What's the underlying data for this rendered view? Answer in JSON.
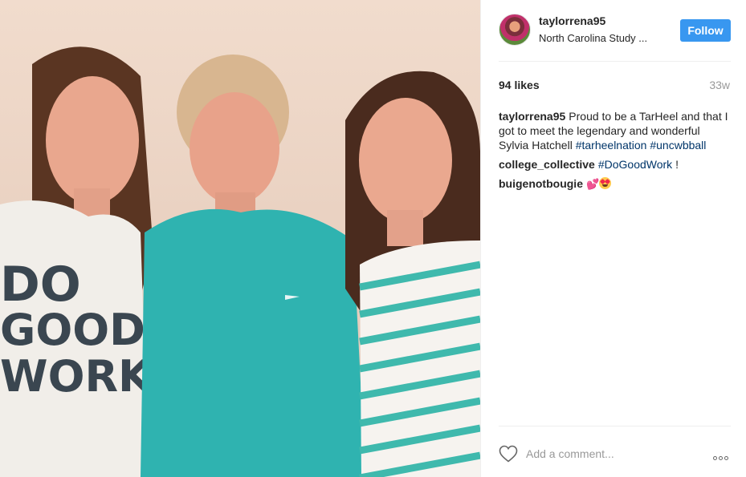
{
  "post": {
    "username": "taylorrena95",
    "location": "North Carolina Study ...",
    "follow_label": "Follow",
    "likes": "94 likes",
    "time_ago": "33w"
  },
  "comments": [
    {
      "user": "taylorrena95",
      "text": "Proud to be a TarHeel and that I got to meet the legendary and wonderful Sylvia Hatchell",
      "hashtags": [
        "#tarheelnation",
        "#uncwbball"
      ]
    },
    {
      "user": "college_collective",
      "hashtag": "#DoGoodWork",
      "suffix": "!"
    },
    {
      "user": "buigenotbougie",
      "emojis": [
        "💕",
        "😍"
      ]
    }
  ],
  "shirt_text": [
    "DO",
    "GOOD",
    "WORK"
  ],
  "add_comment_placeholder": "Add a comment...",
  "icons": {
    "like": "heart-outline-icon",
    "more": "more-options-icon"
  },
  "colors": {
    "follow_button": "#3897f0",
    "hashtag": "#003569",
    "meta_gray": "#999999",
    "divider": "#efefef"
  }
}
